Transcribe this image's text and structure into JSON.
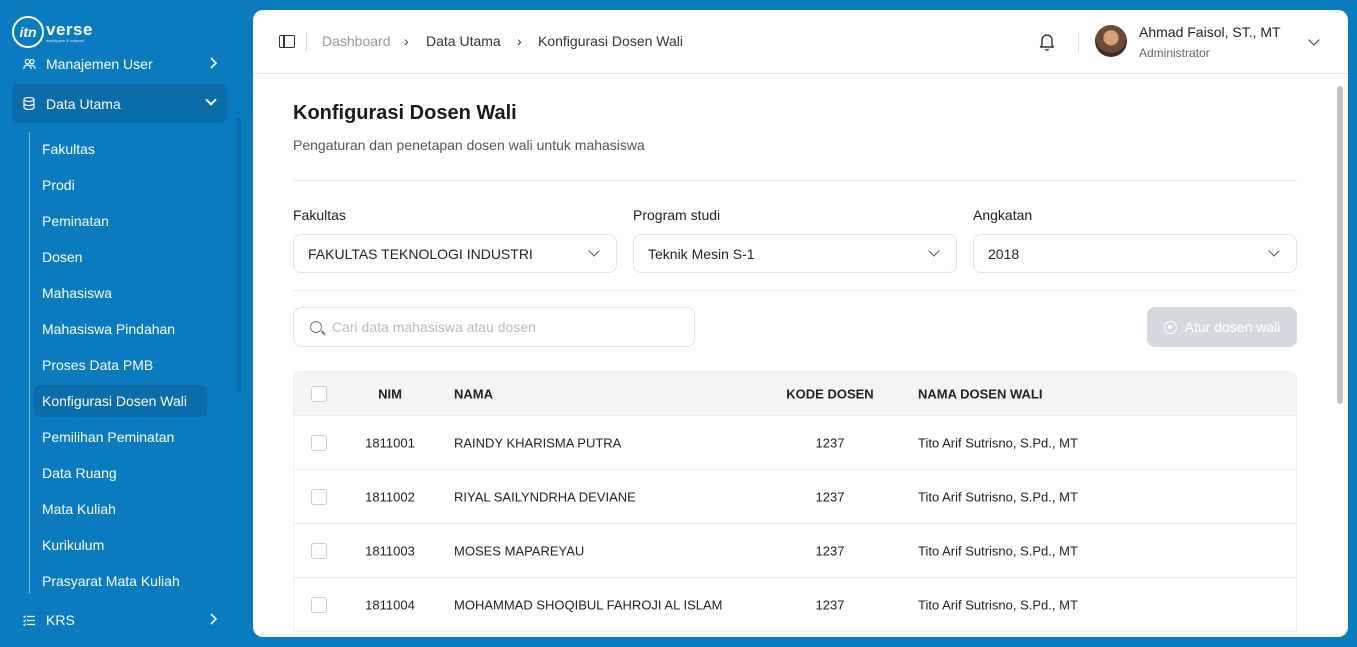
{
  "brand": {
    "logo_mark": "itn",
    "logo_word": "verse",
    "logo_sub": "workspace & network"
  },
  "sidebar": {
    "top_item": {
      "label": "Manajemen User",
      "icon": "users-icon"
    },
    "active_group": {
      "label": "Data Utama",
      "icon": "database-icon"
    },
    "sub_items": [
      {
        "label": "Fakultas"
      },
      {
        "label": "Prodi"
      },
      {
        "label": "Peminatan"
      },
      {
        "label": "Dosen"
      },
      {
        "label": "Mahasiswa"
      },
      {
        "label": "Mahasiswa Pindahan"
      },
      {
        "label": "Proses Data PMB"
      },
      {
        "label": "Konfigurasi Dosen Wali"
      },
      {
        "label": "Pemilihan Peminatan"
      },
      {
        "label": "Data Ruang"
      },
      {
        "label": "Mata Kuliah"
      },
      {
        "label": "Kurikulum"
      },
      {
        "label": "Prasyarat Mata Kuliah"
      }
    ],
    "active_sub": "Konfigurasi Dosen Wali",
    "bottom_item": {
      "label": "KRS",
      "icon": "list-icon"
    }
  },
  "breadcrumb": {
    "items": [
      "Dashboard",
      "Data Utama",
      "Konfigurasi Dosen Wali"
    ],
    "separator": "›"
  },
  "user": {
    "name": "Ahmad Faisol, ST., MT",
    "role": "Administrator"
  },
  "page": {
    "title": "Konfigurasi Dosen Wali",
    "subtitle": "Pengaturan dan penetapan dosen wali untuk mahasiswa"
  },
  "filters": {
    "fakultas": {
      "label": "Fakultas",
      "value": "FAKULTAS TEKNOLOGI INDUSTRI"
    },
    "prodi": {
      "label": "Program studi",
      "value": "Teknik Mesin S-1"
    },
    "angkatan": {
      "label": "Angkatan",
      "value": "2018"
    }
  },
  "search": {
    "placeholder": "Cari data mahasiswa atau dosen",
    "value": ""
  },
  "actions": {
    "atur_label": "Atur dosen wali"
  },
  "table": {
    "columns": {
      "nim": "NIM",
      "nama": "NAMA",
      "kode": "KODE DOSEN",
      "wali": "NAMA DOSEN WALI"
    },
    "rows": [
      {
        "nim": "1811001",
        "nama": "RAINDY KHARISMA PUTRA",
        "kode": "1237",
        "wali": "Tito Arif Sutrisno, S.Pd., MT"
      },
      {
        "nim": "1811002",
        "nama": "RIYAL SAILYNDRHA DEVIANE",
        "kode": "1237",
        "wali": "Tito Arif Sutrisno, S.Pd., MT"
      },
      {
        "nim": "1811003",
        "nama": "MOSES MAPAREYAU",
        "kode": "1237",
        "wali": "Tito Arif Sutrisno, S.Pd., MT"
      },
      {
        "nim": "1811004",
        "nama": "MOHAMMAD SHOQIBUL FAHROJI AL ISLAM",
        "kode": "1237",
        "wali": "Tito Arif Sutrisno, S.Pd., MT"
      }
    ]
  },
  "colors": {
    "sidebar": "#0b7bbf",
    "sidebar_active": "#0a6daa",
    "button_disabled": "#d5d9df"
  }
}
